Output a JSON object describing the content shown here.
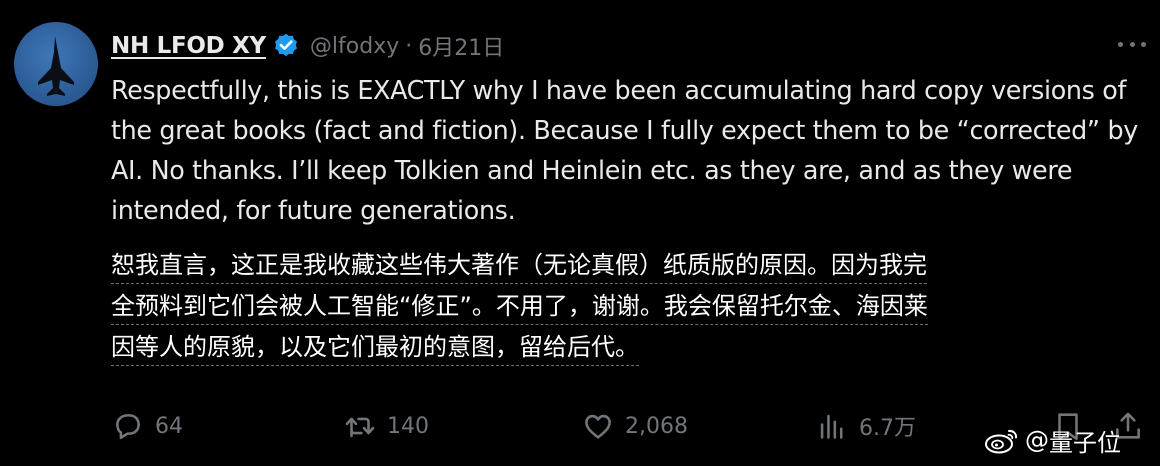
{
  "author": {
    "display_name": "NH LFOD XY",
    "handle": "@lfodxy",
    "separator": "·",
    "date": "6月21日",
    "verified": true,
    "avatar_icon": "jet-silhouette-avatar"
  },
  "tweet": {
    "text_en": "Respectfully, this is EXACTLY why I have been accumulating hard copy versions of the great books (fact and fiction). Because I fully expect them to be “corrected” by AI. No thanks. I’ll keep Tolkien and Heinlein etc. as they are, and as they were intended, for future generations.",
    "translation_lines": [
      "恕我直言，这正是我收藏这些伟大著作（无论真假）纸质版的原因。因为我完",
      "全预料到它们会被人工智能“修正”。不用了，谢谢。我会保留托尔金、海因莱",
      "因等人的原貌，以及它们最初的意图，留给后代。"
    ]
  },
  "actions": {
    "reply_count": "64",
    "retweet_count": "140",
    "like_count": "2,068",
    "views_count": "6.7万"
  },
  "watermark": {
    "prefix": "@",
    "name": "量子位"
  },
  "colors": {
    "background": "#000000",
    "text": "#e7e9ea",
    "muted": "#71767b",
    "verified_blue": "#1d9bf0",
    "avatar_blue": "#2e5f9a"
  }
}
